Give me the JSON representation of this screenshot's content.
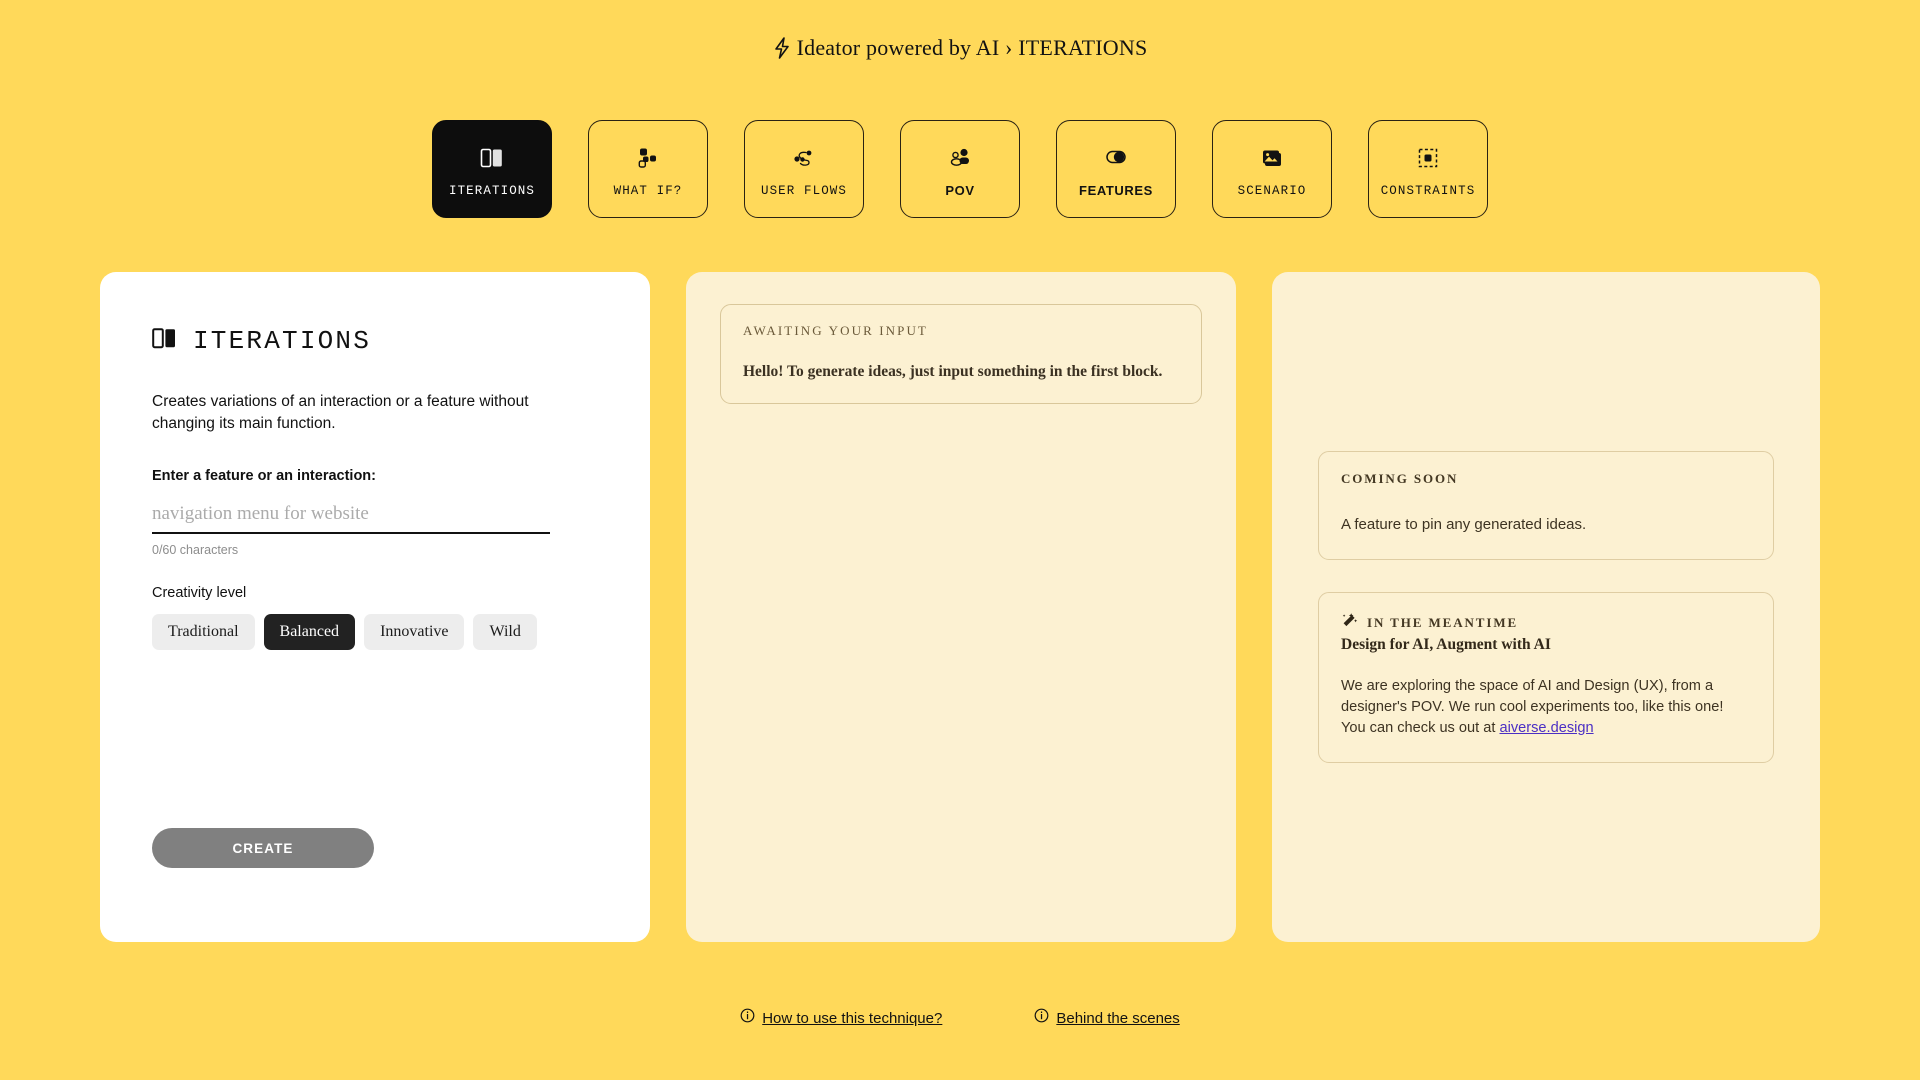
{
  "header": {
    "icon": "lightning-bolt-icon",
    "title": "Ideator powered by AI › ITERATIONS"
  },
  "tabs": [
    {
      "label": "ITERATIONS",
      "icon": "two-panels-icon",
      "active": true
    },
    {
      "label": "WHAT IF?",
      "icon": "scattered-squares-icon",
      "active": false
    },
    {
      "label": "USER FLOWS",
      "icon": "flow-nodes-icon",
      "active": false
    },
    {
      "label": "POV",
      "icon": "people-icon",
      "active": false
    },
    {
      "label": "FEATURES",
      "icon": "toggle-circle-icon",
      "active": false
    },
    {
      "label": "SCENARIO",
      "icon": "images-stack-icon",
      "active": false
    },
    {
      "label": "CONSTRAINTS",
      "icon": "dashed-frame-icon",
      "active": false
    }
  ],
  "left_panel": {
    "icon": "two-panels-icon",
    "title": "ITERATIONS",
    "description": "Creates variations of an interaction or a feature without changing its main function.",
    "field_label": "Enter a feature or an interaction:",
    "input_value": "",
    "input_placeholder": "navigation menu for website",
    "char_count": "0/60 characters",
    "creativity_label": "Creativity level",
    "creativity_options": [
      "Traditional",
      "Balanced",
      "Innovative",
      "Wild"
    ],
    "creativity_selected": "Balanced",
    "create_label": "CREATE"
  },
  "middle_panel": {
    "kicker": "AWAITING YOUR INPUT",
    "message": "Hello! To generate ideas, just input something in the first block."
  },
  "right_panel": {
    "coming_soon": {
      "kicker": "COMING SOON",
      "text": "A feature to pin any generated ideas."
    },
    "meantime": {
      "icon": "magic-wand-icon",
      "kicker": "IN THE MEANTIME",
      "subtitle": "Design for AI, Augment with AI",
      "paragraph_before": "We are exploring the space of AI and Design (UX), from a designer's POV. We run cool experiments too, like this one! You can check us out at ",
      "link": "aiverse.design"
    }
  },
  "footer": {
    "links": [
      {
        "icon": "info-icon",
        "label": "How to use this technique?"
      },
      {
        "icon": "info-icon",
        "label": "Behind the scenes"
      }
    ]
  },
  "colors": {
    "background": "#FFD95A",
    "panel_cream": "#FCF1D2",
    "panel_white": "#FFFFFF",
    "active_tab": "#0D0D0D",
    "create_disabled": "#808080",
    "link": "#4B2FC4"
  }
}
